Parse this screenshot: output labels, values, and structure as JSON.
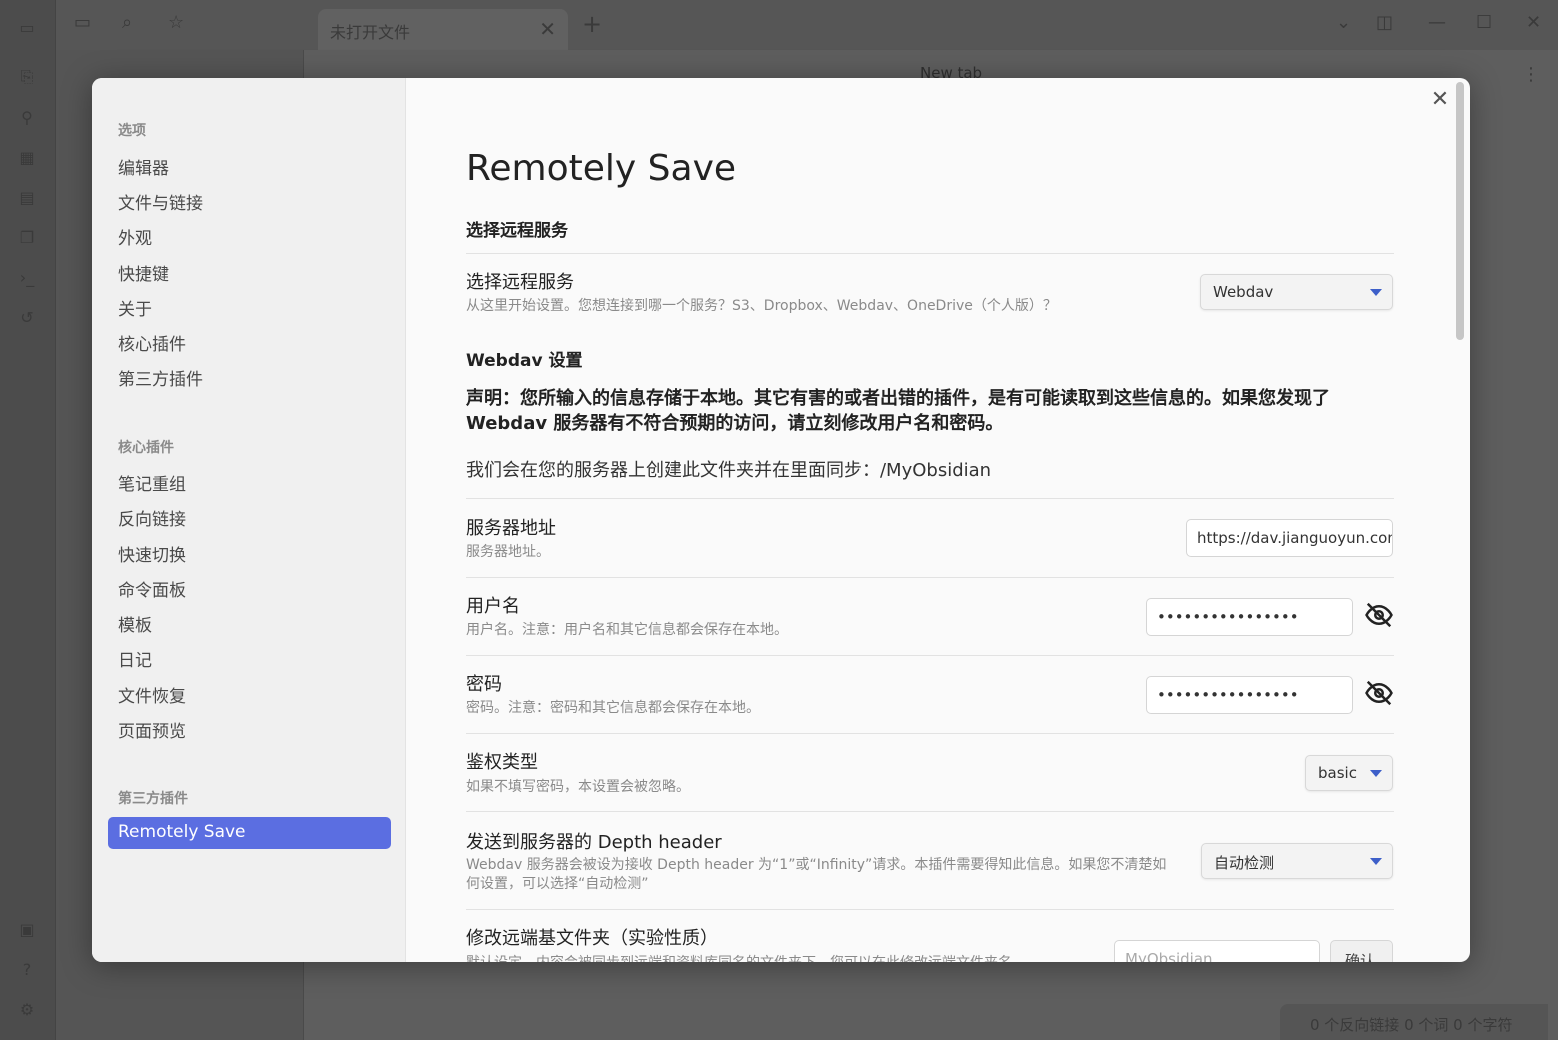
{
  "app": {
    "tab_title": "未打开文件",
    "tab_close": "✕",
    "new_tab": "+",
    "main_title": "New tab",
    "status": "0 个反向链接   0 个词   0 个字符"
  },
  "settings": {
    "close": "✕",
    "sidebar": {
      "groups": [
        {
          "title": "选项",
          "items": [
            "编辑器",
            "文件与链接",
            "外观",
            "快捷键",
            "关于",
            "核心插件",
            "第三方插件"
          ]
        },
        {
          "title": "核心插件",
          "items": [
            "笔记重组",
            "反向链接",
            "快速切换",
            "命令面板",
            "模板",
            "日记",
            "文件恢复",
            "页面预览"
          ]
        },
        {
          "title": "第三方插件",
          "items": [
            "Remotely Save"
          ]
        }
      ],
      "active": "Remotely Save"
    },
    "page_title": "Remotely Save",
    "remote_section": {
      "heading": "选择远程服务",
      "service": {
        "name": "选择远程服务",
        "desc": "从这里开始设置。您想连接到哪一个服务？S3、Dropbox、Webdav、OneDrive（个人版）？",
        "value": "Webdav"
      }
    },
    "webdav_section": {
      "heading": "Webdav 设置",
      "notice_line1": "声明：您所输入的信息存储于本地。其它有害的或者出错的插件，是有可能读取到这些信息的。如果您发现了",
      "notice_line2": "Webdav 服务器有不符合预期的访问，请立刻修改用户名和密码。",
      "sync_note": "我们会在您的服务器上创建此文件夹并在里面同步：/MyObsidian",
      "server": {
        "name": "服务器地址",
        "desc": "服务器地址。",
        "value": "https://dav.jianguoyun.com"
      },
      "username": {
        "name": "用户名",
        "desc": "用户名。注意：用户名和其它信息都会保存在本地。",
        "value": "••••••••••••••••"
      },
      "password": {
        "name": "密码",
        "desc": "密码。注意：密码和其它信息都会保存在本地。",
        "value": "••••••••••••••••"
      },
      "auth": {
        "name": "鉴权类型",
        "desc": "如果不填写密码，本设置会被忽略。",
        "value": "basic"
      },
      "depth": {
        "name": "发送到服务器的 Depth header",
        "desc_line1": "Webdav 服务器会被设为接收 Depth header 为“1”或“Infinity”请求。本插件需要得知此信息。如果您不清楚如",
        "desc_line2": "何设置，可以选择“自动检测”",
        "value": "自动检测"
      },
      "remote_base": {
        "name": "修改远端基文件夹（实验性质）",
        "desc": "默认设定，内容会被同步到远端和资料库同名的文件夹下。您可以在此修改远端文件夹名",
        "placeholder": "MyObsidian",
        "button": "确认"
      }
    }
  }
}
